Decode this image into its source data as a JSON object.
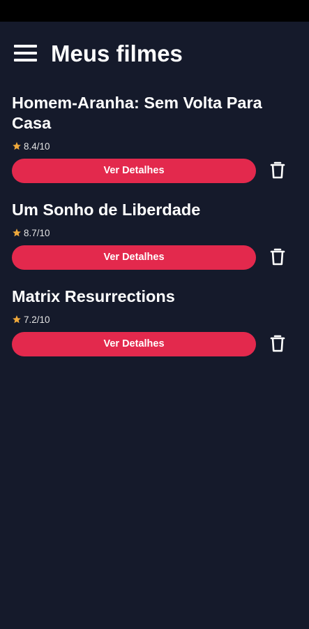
{
  "header": {
    "title": "Meus filmes",
    "menu_icon": "hamburger-menu-icon"
  },
  "colors": {
    "background": "#151a2b",
    "accent": "#e3294d",
    "star": "#f0a93b"
  },
  "movies": [
    {
      "title": "Homem-Aranha: Sem Volta Para Casa",
      "rating": "8.4/10",
      "details_label": "Ver Detalhes",
      "delete_icon": "trash-icon"
    },
    {
      "title": "Um Sonho de Liberdade",
      "rating": "8.7/10",
      "details_label": "Ver Detalhes",
      "delete_icon": "trash-icon"
    },
    {
      "title": "Matrix Resurrections",
      "rating": "7.2/10",
      "details_label": "Ver Detalhes",
      "delete_icon": "trash-icon"
    }
  ]
}
